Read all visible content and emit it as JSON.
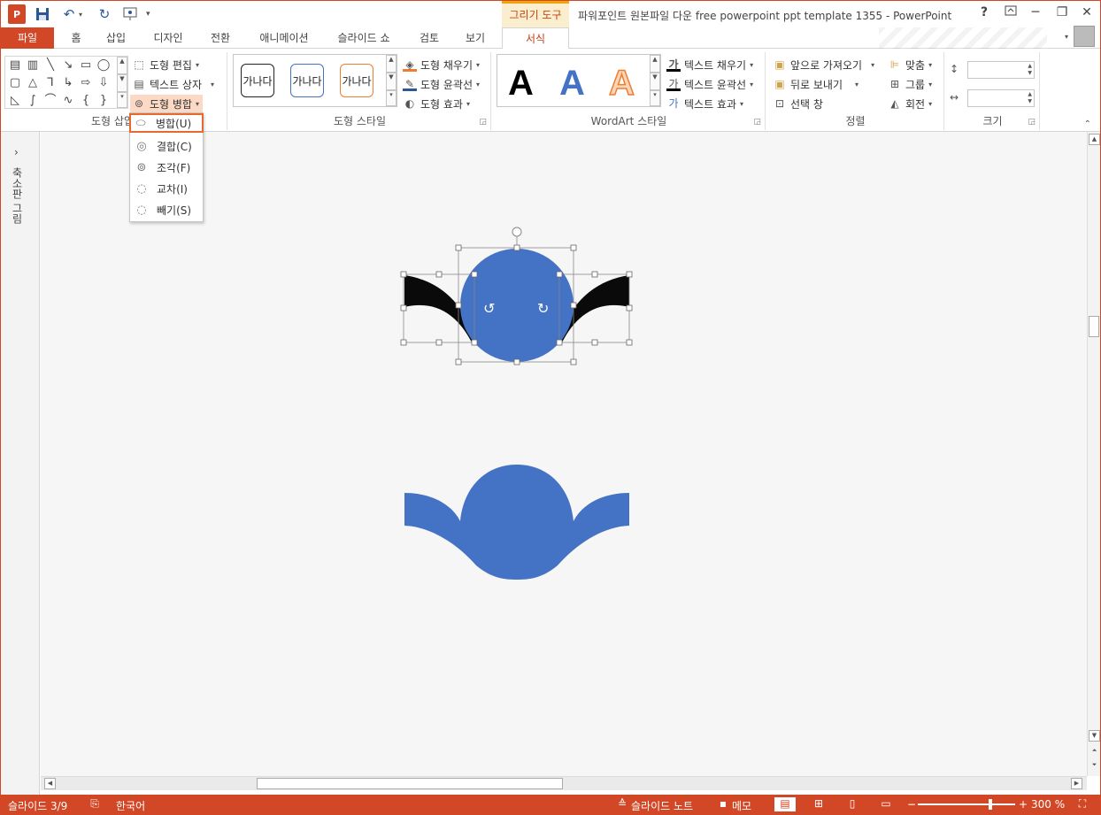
{
  "window": {
    "context_tab": "그리기 도구",
    "title": "파워포인트 원본파일 다운 free powerpoint ppt template 1355 - PowerPoint",
    "help": "?",
    "min": "─",
    "restore": "❐",
    "close": "✕"
  },
  "tabs": [
    "파일",
    "홈",
    "삽입",
    "디자인",
    "전환",
    "애니메이션",
    "슬라이드 쇼",
    "검토",
    "보기",
    "서식"
  ],
  "ribbon": {
    "insert_shapes": {
      "label": "도형 삽입",
      "edit_shape": "도형 편집",
      "text_box": "텍스트 상자",
      "merge_shapes": "도형 병합"
    },
    "shape_styles": {
      "label": "도형 스타일",
      "swatch_text": "가나다",
      "fill": "도형 채우기",
      "outline": "도형 윤곽선",
      "effects": "도형 효과"
    },
    "wordart": {
      "label": "WordArt 스타일",
      "letter": "A",
      "text_fill": "텍스트 채우기",
      "text_outline": "텍스트 윤곽선",
      "text_effects": "텍스트 효과"
    },
    "arrange": {
      "label": "정렬",
      "bring_forward": "앞으로 가져오기",
      "send_backward": "뒤로 보내기",
      "selection_pane": "선택 창",
      "align": "맞춤",
      "group": "그룹",
      "rotate": "회전"
    },
    "size": {
      "label": "크기",
      "height": "",
      "width": ""
    }
  },
  "merge_menu": [
    {
      "label": "병합(U)",
      "highlighted": true
    },
    {
      "label": "결합(C)"
    },
    {
      "label": "조각(F)"
    },
    {
      "label": "교차(I)"
    },
    {
      "label": "빼기(S)"
    }
  ],
  "left_pane": {
    "label": "축소판 그림"
  },
  "status": {
    "slide": "슬라이드 3/9",
    "language": "한국어",
    "notes": "슬라이드 노트",
    "comments": "메모",
    "zoom": "300 %"
  },
  "colors": {
    "accent": "#d24726",
    "shape_blue": "#4472c4",
    "shape_black": "#0a0a0a",
    "highlight": "#e8692d"
  }
}
